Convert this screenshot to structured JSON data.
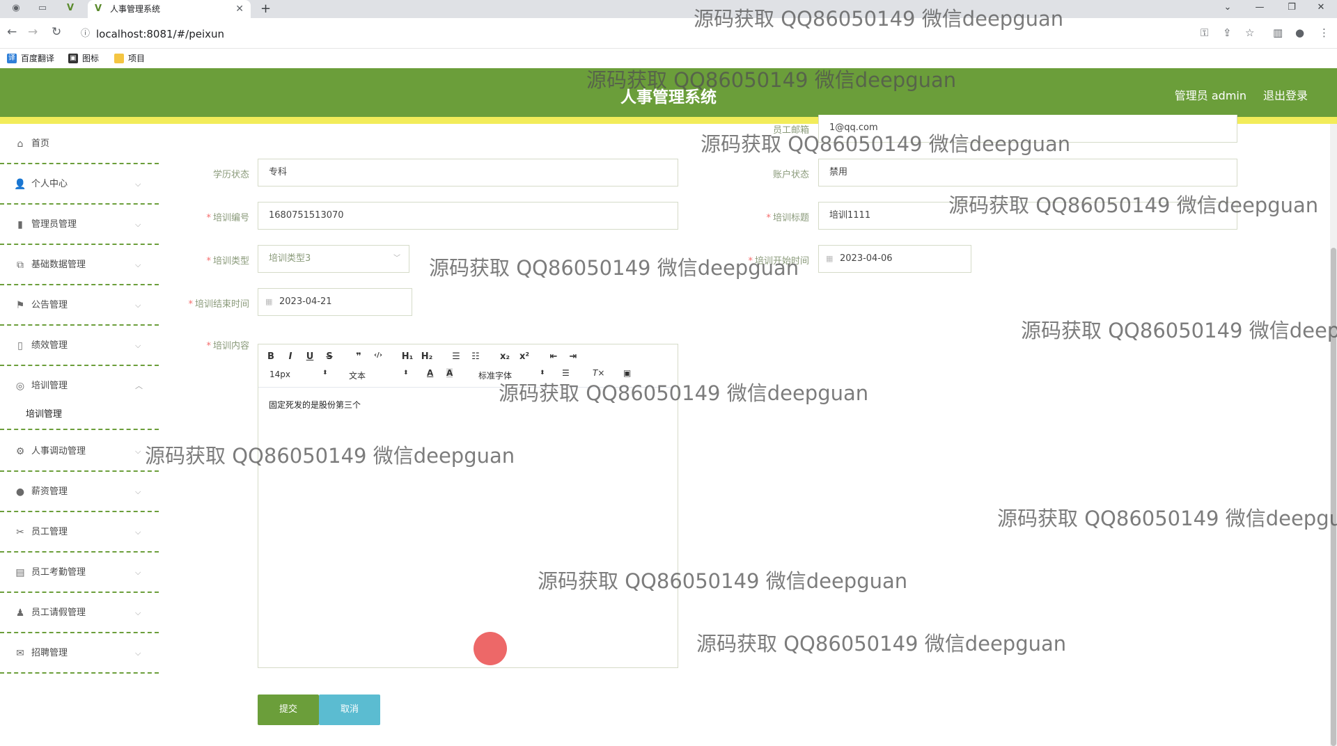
{
  "browser": {
    "tab_title": "人事管理系统",
    "url": "localhost:8081/#/peixun",
    "bookmarks": [
      {
        "label": "百度翻译",
        "icon": "translate-icon",
        "color": "#2f7fd8"
      },
      {
        "label": "图标",
        "icon": "image-icon",
        "color": "#333333"
      },
      {
        "label": "项目",
        "icon": "folder-icon",
        "color": "#f4c542"
      }
    ]
  },
  "header": {
    "title": "人事管理系统",
    "user": "管理员 admin",
    "logout": "退出登录",
    "bg_color": "#6b9e3a",
    "strip_color": "#f2ec5a"
  },
  "sidebar": {
    "items": [
      {
        "label": "首页",
        "icon": "home-icon"
      },
      {
        "label": "个人中心",
        "icon": "user-icon"
      },
      {
        "label": "管理员管理",
        "icon": "chart-icon"
      },
      {
        "label": "基础数据管理",
        "icon": "copy-icon"
      },
      {
        "label": "公告管理",
        "icon": "flag-icon"
      },
      {
        "label": "绩效管理",
        "icon": "bottle-icon"
      },
      {
        "label": "培训管理",
        "icon": "globe-icon",
        "expanded": true
      },
      {
        "label": "人事调动管理",
        "icon": "settings-icon"
      },
      {
        "label": "薪资管理",
        "icon": "balloon-icon"
      },
      {
        "label": "员工管理",
        "icon": "ticket-icon"
      },
      {
        "label": "员工考勤管理",
        "icon": "clipboard-icon"
      },
      {
        "label": "员工请假管理",
        "icon": "person-icon"
      },
      {
        "label": "招聘管理",
        "icon": "mail-icon"
      }
    ],
    "sub_item": "培训管理"
  },
  "form": {
    "email": {
      "label": "员工邮箱",
      "value": "1@qq.com"
    },
    "education": {
      "label": "学历状态",
      "value": "专科"
    },
    "account": {
      "label": "账户状态",
      "value": "禁用"
    },
    "train_no": {
      "label": "培训编号",
      "value": "1680751513070"
    },
    "train_title": {
      "label": "培训标题",
      "value": "培训1111"
    },
    "train_type": {
      "label": "培训类型",
      "value": "培训类型3"
    },
    "start_time": {
      "label": "培训开始时间",
      "value": "2023-04-06"
    },
    "end_time": {
      "label": "培训结束时间",
      "value": "2023-04-21"
    },
    "content": {
      "label": "培训内容",
      "value": "固定死发的是股份第三个"
    }
  },
  "editor_toolbar": {
    "row1": [
      "B",
      "I",
      "U",
      "S",
      "❞",
      "‹/›",
      "H₁",
      "H₂",
      "☰",
      "☷",
      "x₂",
      "x²",
      "⇤",
      "⇥"
    ],
    "font_size": "14px",
    "header": "文本",
    "font": "标准字体"
  },
  "buttons": {
    "submit": "提交",
    "cancel": "取消"
  },
  "watermark": "源码获取 QQ86050149 微信deepguan"
}
